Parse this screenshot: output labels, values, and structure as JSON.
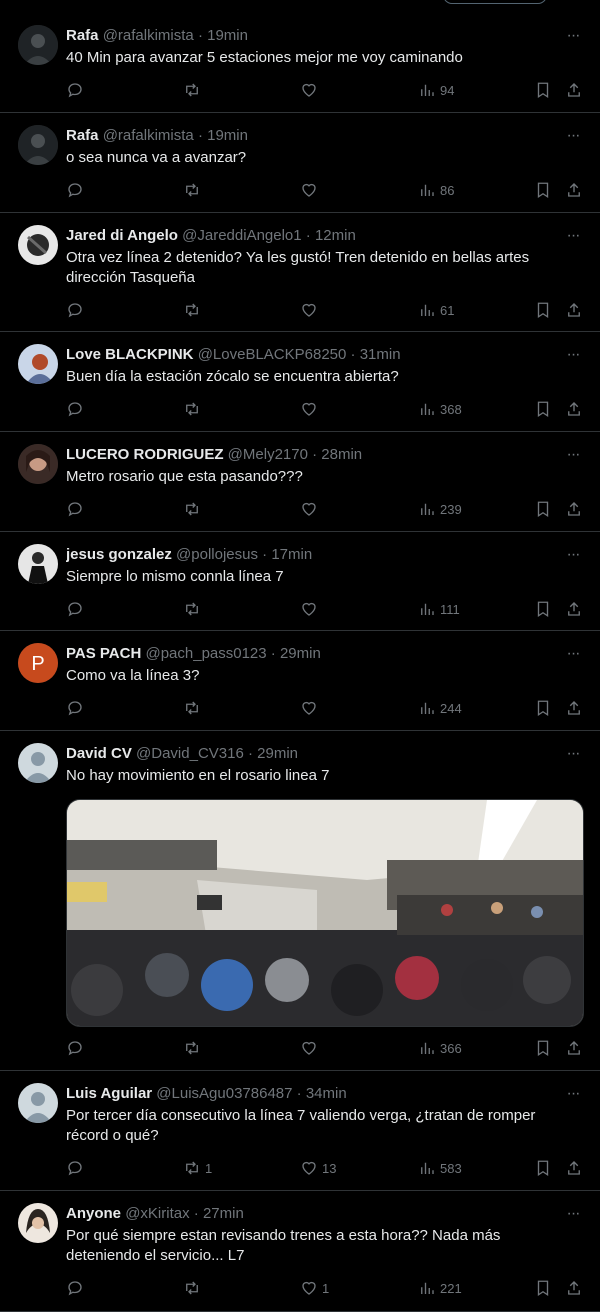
{
  "tweets": [
    {
      "name": "Rafa",
      "handle": "@rafalkimista",
      "time": "19min",
      "text": "40 Min para avanzar 5 estaciones mejor me voy caminando",
      "replies": "",
      "retweets": "",
      "likes": "",
      "views": "94"
    },
    {
      "name": "Rafa",
      "handle": "@rafalkimista",
      "time": "19min",
      "text": "o sea nunca va a avanzar?",
      "replies": "",
      "retweets": "",
      "likes": "",
      "views": "86"
    },
    {
      "name": "Jared di Angelo",
      "handle": "@JareddiAngelo1",
      "time": "12min",
      "text": "Otra vez línea 2 detenido? Ya les gustó! Tren detenido en bellas artes dirección Tasqueña",
      "replies": "",
      "retweets": "",
      "likes": "",
      "views": "61"
    },
    {
      "name": "Love BLACKPINK",
      "handle": "@LoveBLACKP68250",
      "time": "31min",
      "text": "Buen día la estación zócalo se encuentra abierta?",
      "replies": "",
      "retweets": "",
      "likes": "",
      "views": "368"
    },
    {
      "name": "LUCERO RODRIGUEZ",
      "handle": "@Mely2170",
      "time": "28min",
      "text": "Metro rosario que esta pasando???",
      "replies": "",
      "retweets": "",
      "likes": "",
      "views": "239"
    },
    {
      "name": "jesus gonzalez",
      "handle": "@pollojesus",
      "time": "17min",
      "text": "Siempre lo mismo connla línea 7",
      "replies": "",
      "retweets": "",
      "likes": "",
      "views": "111"
    },
    {
      "name": "PAS PACH",
      "handle": "@pach_pass0123",
      "time": "29min",
      "text": "Como va la línea 3?",
      "replies": "",
      "retweets": "",
      "likes": "",
      "views": "244",
      "avatar_letter": "P"
    },
    {
      "name": "David CV",
      "handle": "@David_CV316",
      "time": "29min",
      "text": "No hay movimiento en el rosario linea 7",
      "replies": "",
      "retweets": "",
      "likes": "",
      "views": "366"
    },
    {
      "name": "Luis Aguilar",
      "handle": "@LuisAgu03786487",
      "time": "34min",
      "text": "Por tercer día consecutivo la línea 7 valiendo verga, ¿tratan de romper récord o qué?",
      "replies": "",
      "retweets": "1",
      "likes": "13",
      "views": "583"
    },
    {
      "name": "Anyone",
      "handle": "@xKiritax",
      "time": "27min",
      "text": "Por qué siempre estan revisando trenes a esta hora?? Nada más deteniendo el servicio... L7",
      "replies": "",
      "retweets": "",
      "likes": "1",
      "views": "221"
    }
  ],
  "common": {
    "dot": "·",
    "more": "···"
  },
  "colors": {
    "background": "#000000",
    "text": "#e7e9ea",
    "muted": "#71767b",
    "border": "#2f3336",
    "avatar_p": "#c74a1d"
  }
}
